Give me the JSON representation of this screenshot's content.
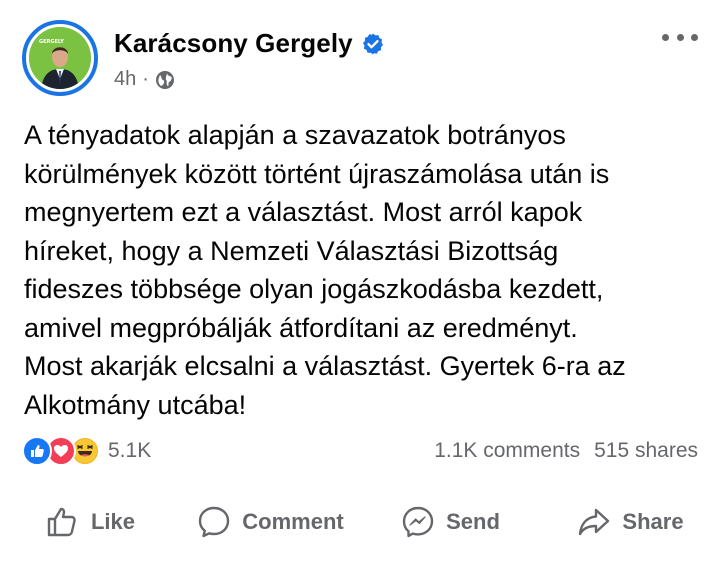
{
  "post": {
    "author": "Karácsony Gergely",
    "time": "4h",
    "separator": "·",
    "audience_icon": "globe-icon",
    "verified_icon": "verified-badge-icon",
    "avatar_text": "GERGELY",
    "text": "A tényadatok alapján a szavazatok botrányos\nkörülmények között történt újraszámolása után is\nmegnyertem ezt a választást. Most arról kapok\nhíreket, hogy a Nemzeti Választási Bizottság\nfideszes többsége olyan jogászkodásba kezdett,\namivel megpróbálják átfordítani az eredményt.\nMost akarják elcsalni a választást. Gyertek 6-ra az\nAlkotmány utcába!"
  },
  "stats": {
    "reaction_icons": [
      "like-icon",
      "love-icon",
      "haha-icon"
    ],
    "reactions": "5.1K",
    "comments": "1.1K comments",
    "shares": "515 shares"
  },
  "actions": {
    "like": "Like",
    "comment": "Comment",
    "send": "Send",
    "share": "Share"
  },
  "colors": {
    "accent": "#1b74e4",
    "like": "#1877f2",
    "love": "#f33e58",
    "haha": "#f7b125",
    "secondary_text": "#65676b",
    "avatar_bg": "#7cc242"
  }
}
